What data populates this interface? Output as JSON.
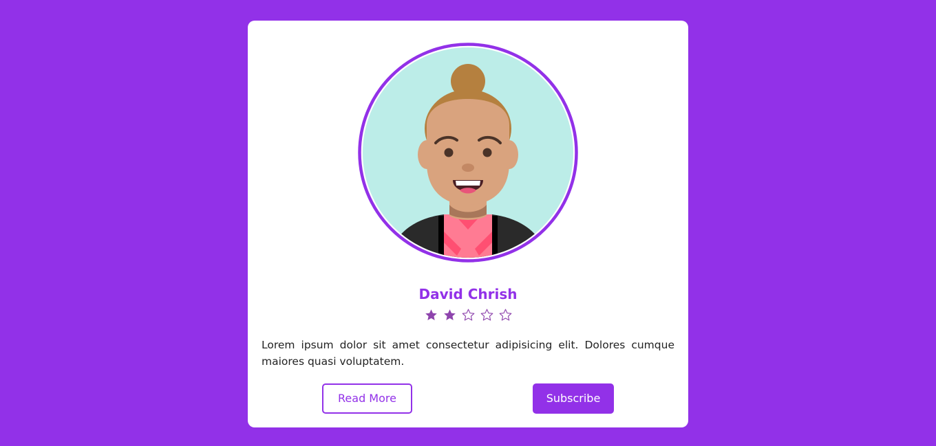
{
  "profile": {
    "name": "David Chrish",
    "rating": 2,
    "rating_max": 5,
    "description": "Lorem ipsum dolor sit amet consectetur adipisicing elit. Dolores cumque maiores quasi voluptatem."
  },
  "actions": {
    "read_more_label": "Read More",
    "subscribe_label": "Subscribe"
  },
  "colors": {
    "background": "#9231e8",
    "accent": "#9231e8",
    "star_filled": "#8e44ad",
    "card": "#ffffff"
  },
  "icons": {
    "avatar": "cartoon-avatar",
    "star_filled": "star-filled-icon",
    "star_empty": "star-outline-icon"
  }
}
